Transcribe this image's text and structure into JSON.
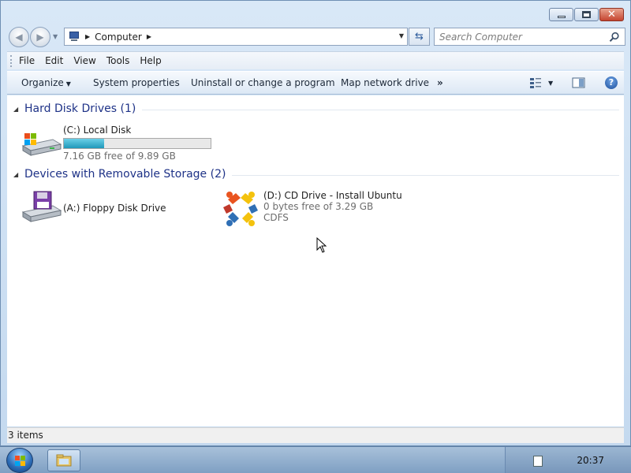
{
  "window": {
    "caption_icons": [
      "minimize-icon",
      "maximize-icon",
      "close-icon"
    ],
    "close_glyph": "✕"
  },
  "nav": {
    "back_glyph": "◀",
    "forward_glyph": "▶",
    "history_glyph": "▼",
    "address_path": "Computer",
    "address_arrow": "▶",
    "dropdown_glyph": "▼",
    "refresh_glyph": "⇆"
  },
  "search": {
    "placeholder": "Search Computer"
  },
  "menu": {
    "items": [
      "File",
      "Edit",
      "View",
      "Tools",
      "Help"
    ]
  },
  "command_bar": {
    "organize": "Organize",
    "organize_arrow": "▼",
    "system_properties": "System properties",
    "uninstall": "Uninstall or change a program",
    "map_network": "Map network drive",
    "more": "»",
    "view_arrow": "▼",
    "help": "?"
  },
  "groups": [
    {
      "title": "Hard Disk Drives (1)",
      "toggle": "◢"
    },
    {
      "title": "Devices with Removable Storage (2)",
      "toggle": "◢"
    }
  ],
  "drives": {
    "c": {
      "name": "(C:) Local Disk",
      "free_text": "7.16 GB free of 9.89 GB",
      "used_fraction": 0.276
    },
    "a": {
      "name": "(A:) Floppy Disk Drive"
    },
    "d": {
      "name": "(D:) CD Drive - Install Ubuntu",
      "free_text": "0 bytes free of 3.29 GB",
      "filesystem": "CDFS"
    }
  },
  "status": {
    "items": "3 items"
  },
  "taskbar": {
    "clock": "20:37"
  },
  "colors": {
    "group_title": "#1e3287",
    "usage_fill": "#1f98b9",
    "ubuntu_orange": "#e95420",
    "ubuntu_yellow": "#f4c20d",
    "ubuntu_blue": "#2f6fb5",
    "ubuntu_red": "#c0392b"
  }
}
